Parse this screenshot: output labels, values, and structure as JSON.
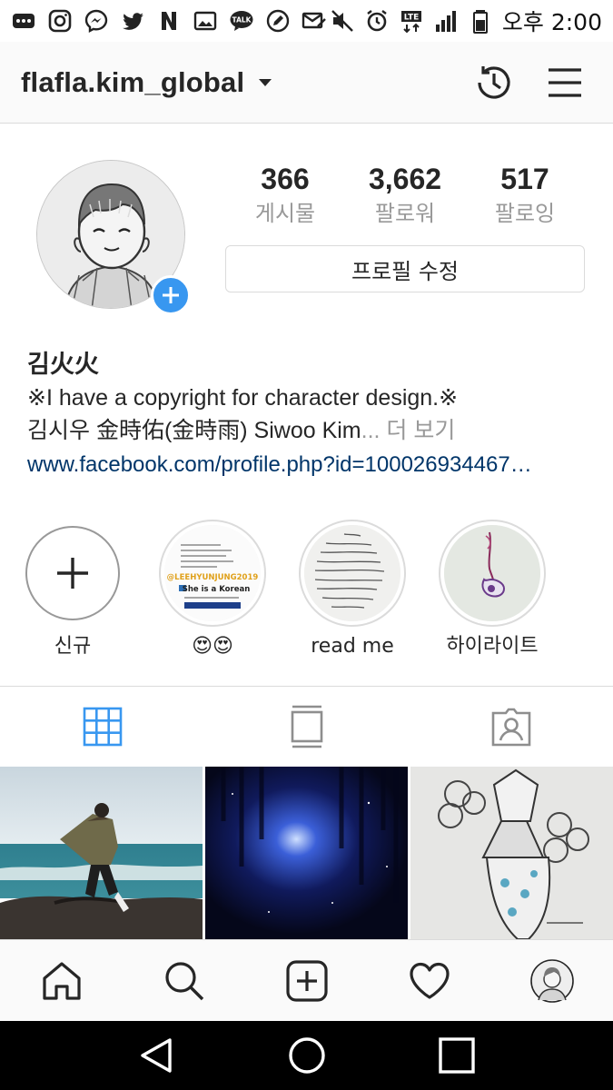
{
  "status_bar": {
    "left_icons": [
      "more-icon",
      "instagram-icon",
      "messenger-icon",
      "twitter-icon",
      "n-app-icon",
      "gallery-icon",
      "talk-icon",
      "edit-icon",
      "mail-icon"
    ],
    "right_icons": [
      "mute-icon",
      "alarm-icon",
      "lte-icon",
      "signal-icon",
      "battery-icon"
    ],
    "time": "오후 2:00"
  },
  "header": {
    "username": "flafla.kim_global"
  },
  "profile": {
    "stats": [
      {
        "value": "366",
        "label": "게시물"
      },
      {
        "value": "3,662",
        "label": "팔로워"
      },
      {
        "value": "517",
        "label": "팔로잉"
      }
    ],
    "edit_button": "프로필 수정",
    "name": "김火火",
    "bio_line1": "※I have a copyright for character design.※",
    "bio_line2": "김시우 金時佑(金時雨) Siwoo Kim",
    "bio_ellipsis": "...",
    "more_label": " 더 보기",
    "link": "www.facebook.com/profile.php?id=100026934467…"
  },
  "highlights": [
    {
      "label": "신규"
    },
    {
      "label": "😍😍",
      "thumb_text_1": "@LEEHYUNJUNG2019",
      "thumb_text_2": "She is a Korean"
    },
    {
      "label": "read me"
    },
    {
      "label": "하이라이트"
    }
  ],
  "tabs": [
    "grid-icon",
    "feed-icon",
    "tagged-icon"
  ],
  "bottom_nav": [
    "home-icon",
    "search-icon",
    "new-post-icon",
    "activity-icon",
    "profile-icon"
  ],
  "colors": {
    "accent": "#3897f0",
    "link": "#003569",
    "muted": "#999999",
    "border": "#dbdbdb"
  }
}
